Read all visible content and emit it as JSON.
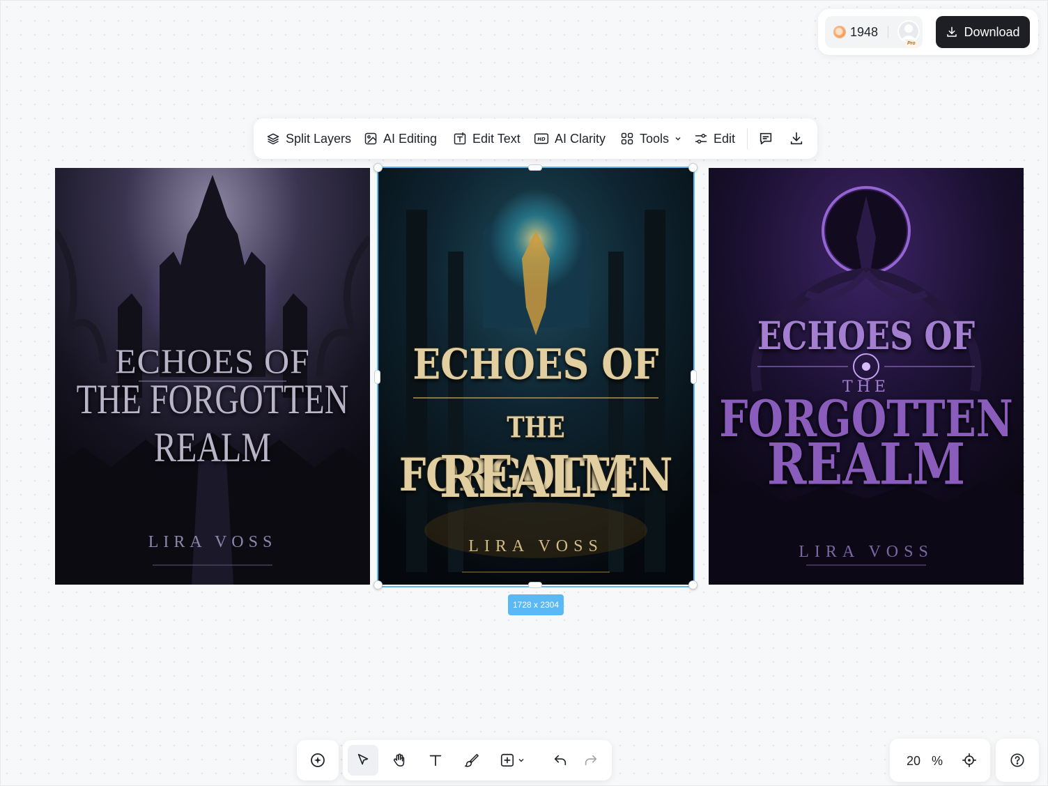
{
  "header": {
    "credits": "1948",
    "avatar_badge": "Pro",
    "download_label": "Download"
  },
  "toolbar": {
    "split_layers": "Split Layers",
    "ai_editing": "AI Editing",
    "edit_text": "Edit Text",
    "ai_clarity": "AI Clarity",
    "tools": "Tools",
    "edit": "Edit"
  },
  "canvas": {
    "selection_size": "1728 x 2304",
    "covers": [
      {
        "title_line1": "ECHOES OF",
        "title_line2": "THE FORGOTTEN REALM",
        "author": "LIRA VOSS"
      },
      {
        "title_line1": "ECHOES OF",
        "title_line2_prefix": "THE",
        "title_line2": "FORGOTTEN",
        "title_line3": "REALM",
        "author": "LIRA VOSS"
      },
      {
        "title_line1": "ECHOES OF",
        "title_the": "THE",
        "title_line2": "FORGOTTEN",
        "title_line3": "REALM",
        "author": "LIRA VOSS"
      }
    ]
  },
  "bottom_toolbar": {
    "zoom_value": "20",
    "zoom_unit": "%"
  },
  "colors": {
    "accent": "#5ab8f5",
    "dark_button": "#1d1f24"
  },
  "icons": [
    "layers-icon",
    "ai-edit-icon",
    "edit-text-icon",
    "hd-icon",
    "grid-icon",
    "chevron-down-icon",
    "sliders-icon",
    "comment-icon",
    "download-icon",
    "sparkle-add-icon",
    "pointer-icon",
    "hand-icon",
    "text-icon",
    "brush-icon",
    "add-box-icon",
    "undo-icon",
    "redo-icon",
    "target-icon",
    "help-icon"
  ]
}
